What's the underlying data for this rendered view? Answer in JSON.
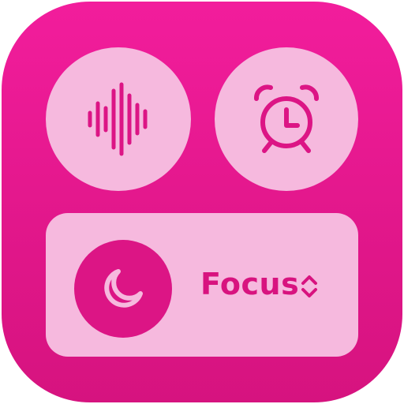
{
  "app": {
    "icons": {
      "voice": "waveform-icon",
      "alarm": "alarm-clock-icon",
      "focus": "moon-icon",
      "selector": "up-down-chevron-icon"
    },
    "colors": {
      "background": "#e41a8f",
      "tile": "#f6b9de",
      "accent": "#dc1585"
    }
  },
  "focus": {
    "label": "Focus"
  }
}
